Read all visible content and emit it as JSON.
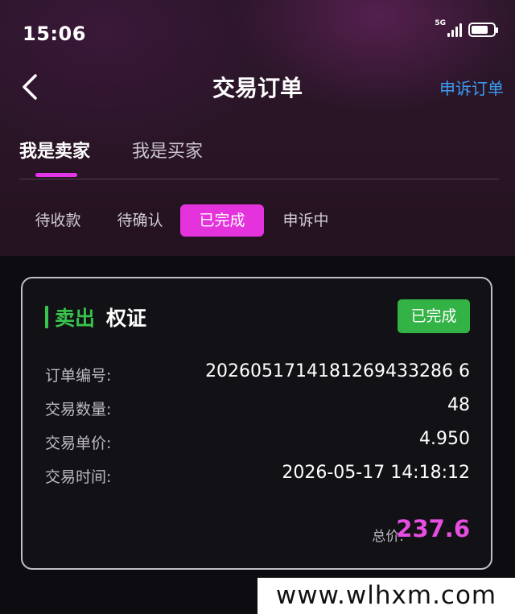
{
  "status_bar": {
    "time": "15:06",
    "network": "5G",
    "battery_level": 0.75
  },
  "header": {
    "title": "交易订单",
    "back_icon": "chevron-left-icon",
    "appeal_link": "申诉订单"
  },
  "role_tabs": [
    {
      "label": "我是卖家",
      "active": true
    },
    {
      "label": "我是买家",
      "active": false
    }
  ],
  "status_tabs": [
    {
      "label": "待收款",
      "active": false
    },
    {
      "label": "待确认",
      "active": false
    },
    {
      "label": "已完成",
      "active": true
    },
    {
      "label": "申诉中",
      "active": false
    }
  ],
  "order": {
    "type": "卖出",
    "asset": "权证",
    "status": "已完成",
    "rows": [
      {
        "label": "订单编号:",
        "value": "2026051714181269433286 6"
      },
      {
        "label": "交易数量:",
        "value": "48"
      },
      {
        "label": "交易单价:",
        "value": "4.950"
      },
      {
        "label": "交易时间:",
        "value": "2026-05-17 14:18:12"
      }
    ],
    "total_label": "总价:",
    "total_value": "237.6"
  },
  "watermark": "www.wlhxm.com",
  "colors": {
    "accent": "#e433dc",
    "link": "#3b9cf3",
    "sell": "#37c24b",
    "badge": "#33b245",
    "total": "#e54ee0"
  }
}
